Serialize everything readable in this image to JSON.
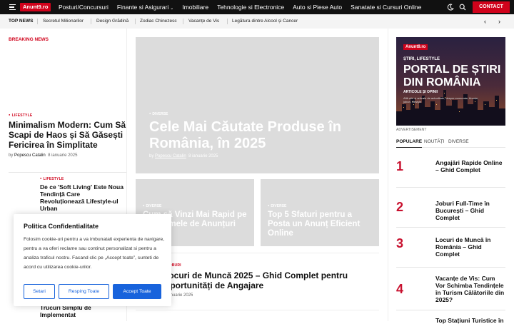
{
  "header": {
    "logo": "Anunt9.ro",
    "nav": [
      "Posturi/Concursuri",
      "Finante si Asigurari",
      "Imobiliare",
      "Tehnologie si Electronice",
      "Auto si Piese Auto",
      "Sanatate si Cursuri Online"
    ],
    "contact": "CONTACT"
  },
  "trending": {
    "label": "TOP NEWS",
    "items": [
      "Secretul Milionarilor",
      "Design Grădină",
      "Zodiac Chinezesc",
      "Vacanțe de Vis",
      "Legătura dintre Alcool și Cancer"
    ]
  },
  "left": {
    "breaking": "BREAKING NEWS",
    "article1": {
      "category": "LIFESTYLE",
      "title": "Minimalism Modern: Cum Să Scapi de Haos și Să Găsești Fericirea în Simplitate",
      "by": "by",
      "author": "Popescu Catalin",
      "date": "8 ianuarie 2025"
    },
    "article2": {
      "category": "LIFESTYLE",
      "title": "De ce 'Soft Living' Este Noua Tendință Care Revoluționează Lifestyle-ul Urban"
    },
    "article3": {
      "title": "Trucuri Simplu de Implementat"
    }
  },
  "hero": {
    "category": "DIVERSE",
    "title": "Cele Mai Căutate Produse în România, în 2025",
    "by": "by",
    "author": "Popescu Catalin",
    "date": "8 ianuarie 2025"
  },
  "cards": [
    {
      "category": "DIVERSE",
      "title": "Cum să Vinzi Mai Rapid pe Platformele de Anunțuri"
    },
    {
      "category": "DIVERSE",
      "title": "Top 5 Sfaturi pentru a Posta un Anunț Eficient Online"
    }
  ],
  "mid": {
    "category": "JOBURI",
    "title": "Locuri de Muncă 2025 – Ghid Complet pentru Oportunități de Angajare",
    "date": "6 ianuarie 2025"
  },
  "ad": {
    "logo": "Anunt9.ro",
    "kicker": "ȘTIRI, LIFESTYLE",
    "title": "PORTAL DE ȘTIRI DIN ROMÂNIA",
    "sub": "ARTICOLE ȘI OPINII",
    "desc": "Află știri și articole de actualitate, despre economie, finanțe, joburi, lifestyle",
    "label": "ADVERTISEMENT"
  },
  "tabs": [
    "POPULARE",
    "NOUTĂȚI",
    "DIVERSE"
  ],
  "popular": [
    {
      "num": "1",
      "title": "Angajări Rapide Online – Ghid Complet"
    },
    {
      "num": "2",
      "title": "Joburi Full-Time în București – Ghid Complet"
    },
    {
      "num": "3",
      "title": "Locuri de Muncă în România – Ghid Complet"
    },
    {
      "num": "4",
      "title": "Vacanțe de Vis: Cum Vor Schimba Tendințele în Turism Călătoriile din 2025?"
    },
    {
      "num": "5",
      "title": "Top Stațiuni Turistice în"
    }
  ],
  "cookie": {
    "title": "Politica Confidentialitate",
    "text": "Folosim cookie-uri pentru a va imbunatati experienta de navigare, pentru a va oferi reclame sau continut personalizat si pentru a analiza traficul nostru. Facand clic pe „Accept toate”, sunteti de acord cu utilizarea cookie-urilor.",
    "settings": "Setari",
    "reject": "Resping Toate",
    "accept": "Accept Toate"
  }
}
